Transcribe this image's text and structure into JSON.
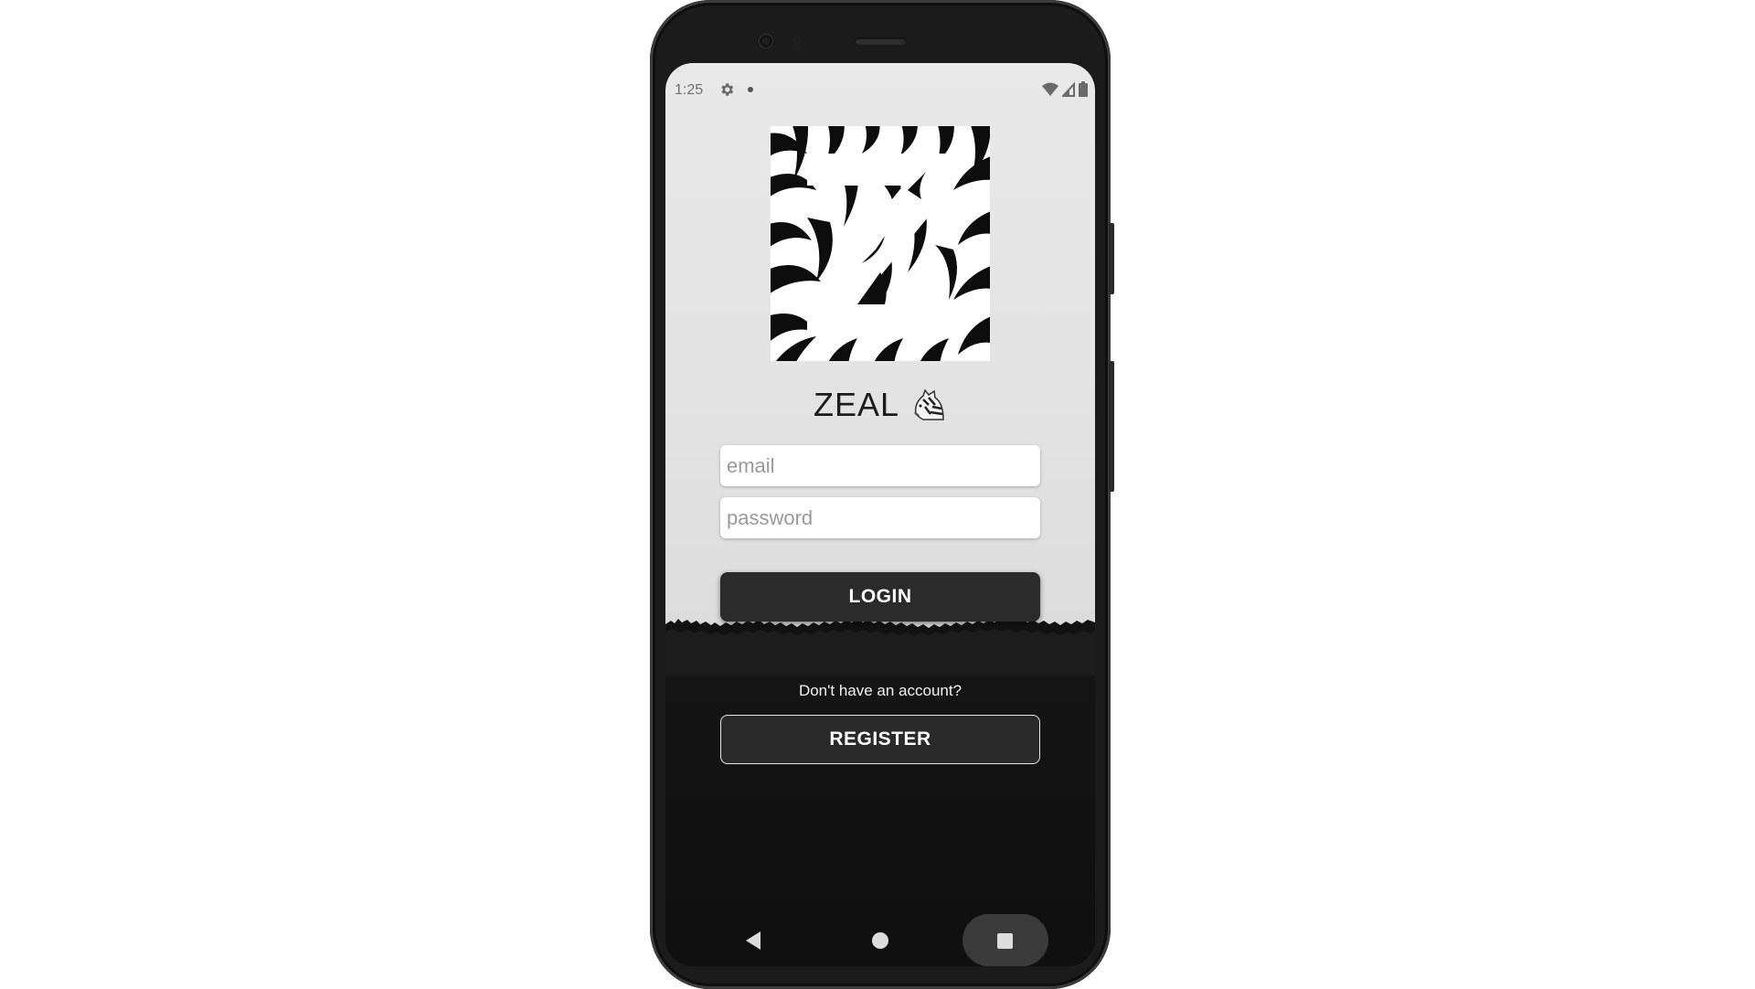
{
  "status_bar": {
    "time": "1:25",
    "icons": [
      "gear-icon",
      "notification-dot-icon",
      "wifi-icon",
      "signal-icon",
      "battery-icon"
    ]
  },
  "app": {
    "title": "ZEAL",
    "logo_icon": "zebra-z-logo",
    "title_icon": "zebra-icon"
  },
  "form": {
    "email_placeholder": "email",
    "password_placeholder": "password",
    "login_label": "LOGIN",
    "no_account_text": "Don't have an account?",
    "register_label": "REGISTER"
  },
  "nav_bar": {
    "icons": [
      "back-icon",
      "home-icon",
      "recents-icon"
    ]
  },
  "colors": {
    "button_bg": "#2b2b2b",
    "top_bg": "#e6e6e6",
    "bottom_bg": "#121212"
  }
}
